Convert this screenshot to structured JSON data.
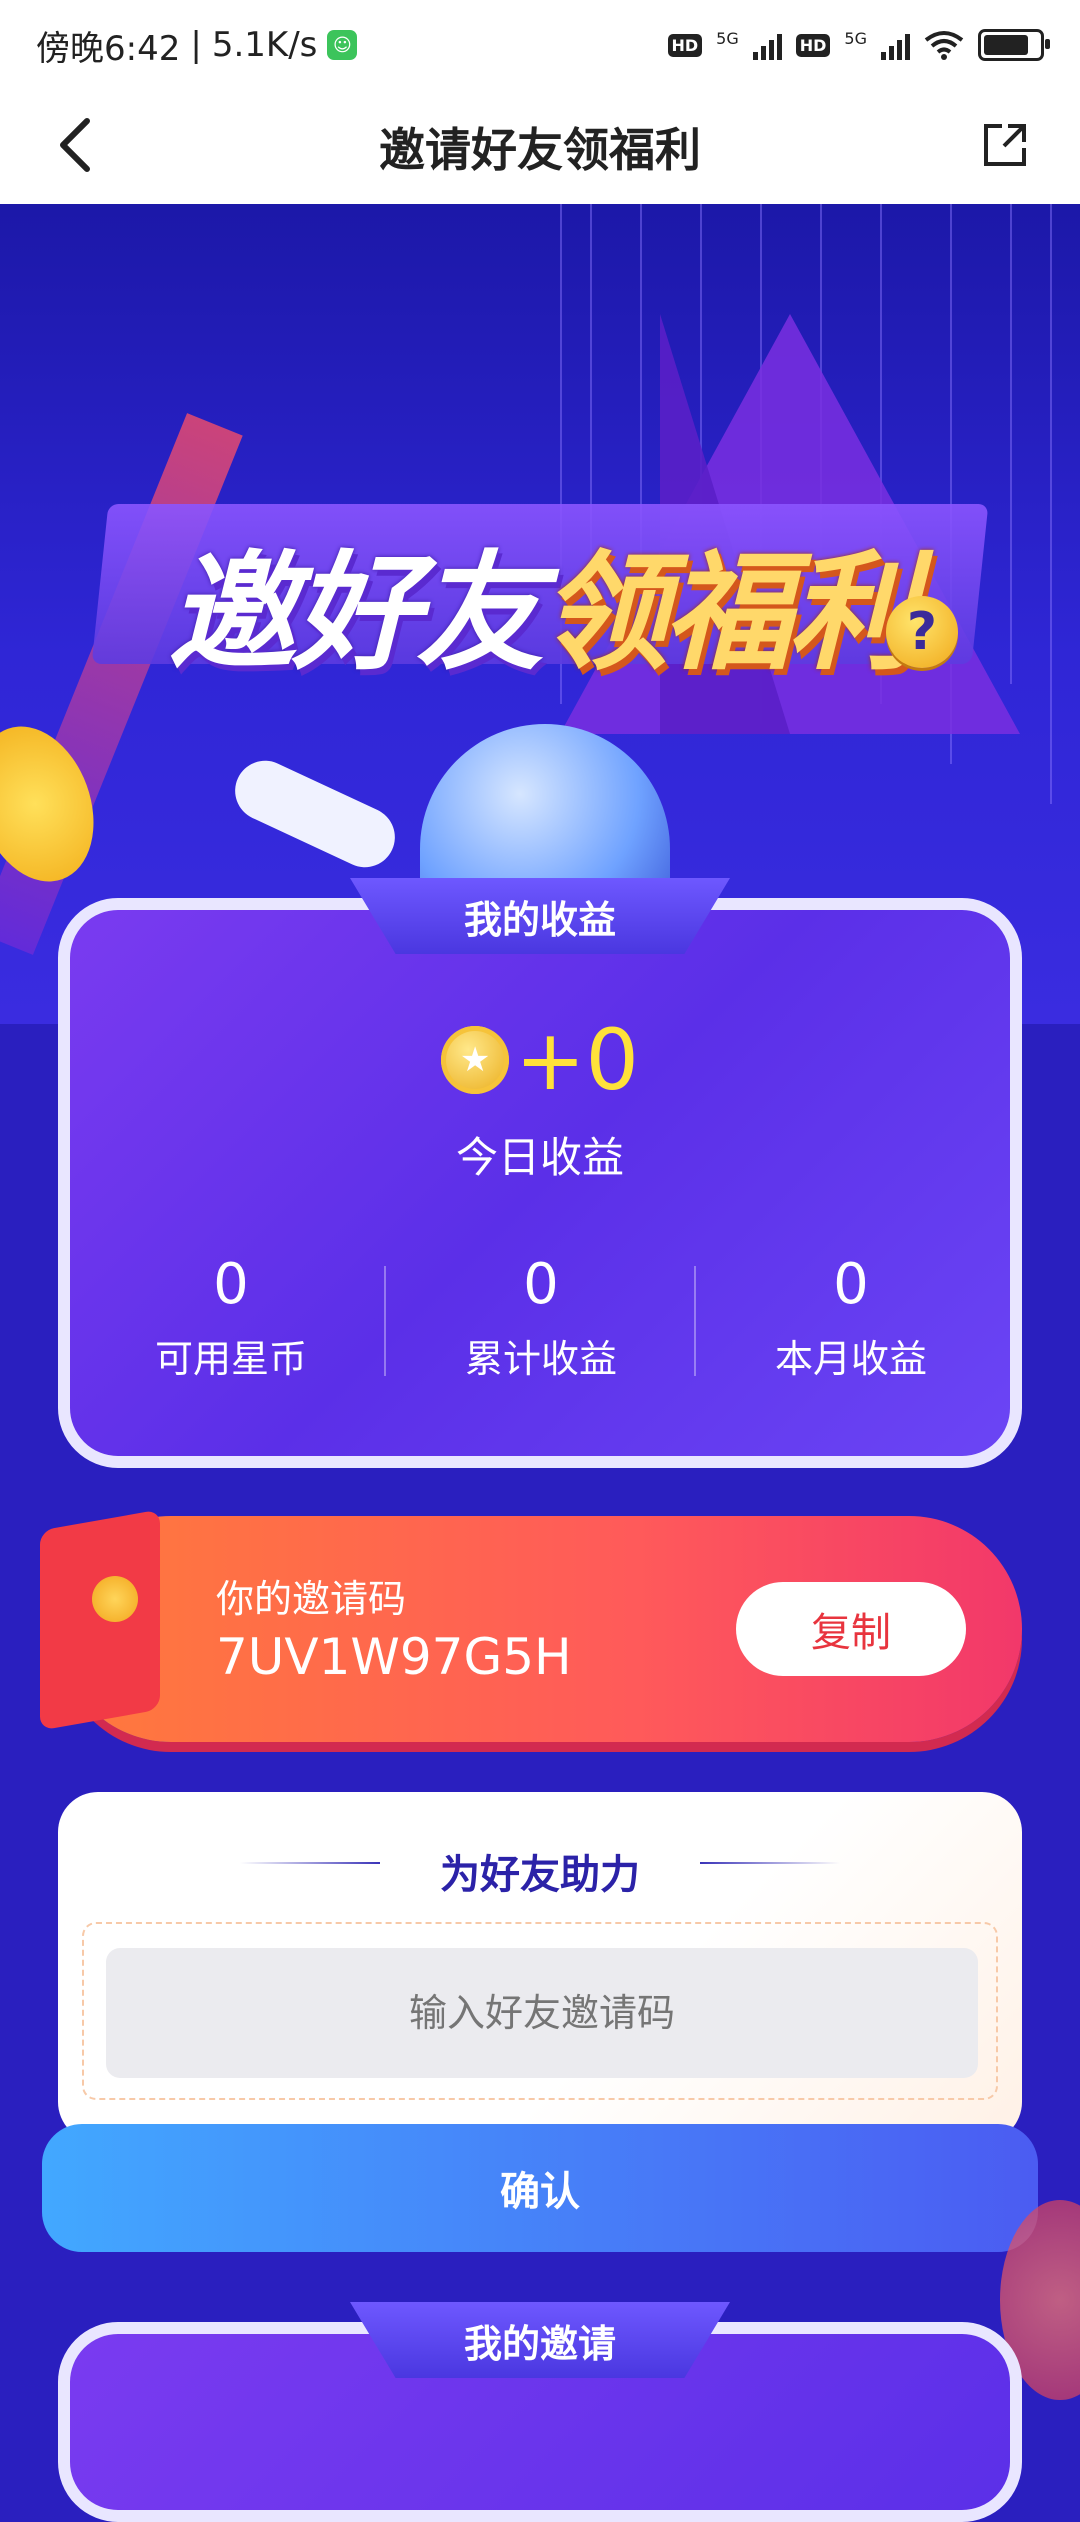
{
  "status_bar": {
    "time": "傍晚6:42",
    "speed": "5.1K/s",
    "hd1": "HD",
    "net1": "5G",
    "hd2": "HD",
    "net2": "5G"
  },
  "header": {
    "title": "邀请好友领福利"
  },
  "hero": {
    "title_white": "邀好友",
    "title_gold": "领福利",
    "help_symbol": "?"
  },
  "earnings": {
    "tab_label": "我的收益",
    "coin_symbol": "★",
    "today_value": "+0",
    "today_label": "今日收益",
    "stats": [
      {
        "value": "0",
        "label": "可用星币"
      },
      {
        "value": "0",
        "label": "累计收益"
      },
      {
        "value": "0",
        "label": "本月收益"
      }
    ]
  },
  "invite_code": {
    "label": "你的邀请码",
    "code": "7UV1W97G5H",
    "copy_label": "复制"
  },
  "help_friend": {
    "title": "为好友助力",
    "input_placeholder": "输入好友邀请码",
    "input_value": "",
    "confirm_label": "确认"
  },
  "my_invites": {
    "tab_label": "我的邀请"
  },
  "colors": {
    "accent_blue": "#2a1fbf",
    "gold": "#ffe13a",
    "copy_red": "#e8343e"
  }
}
